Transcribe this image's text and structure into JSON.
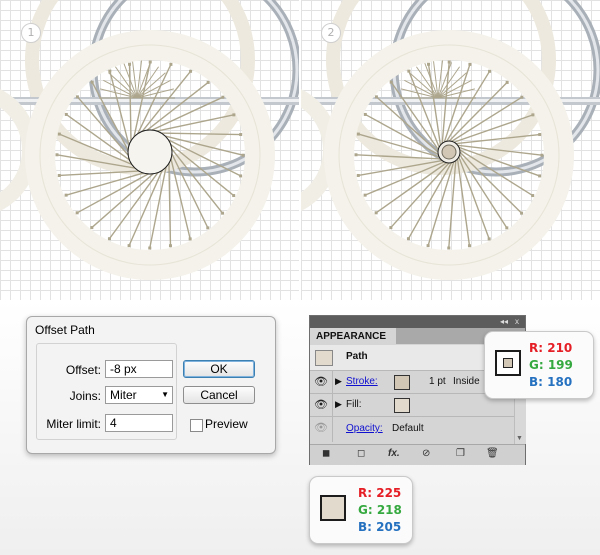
{
  "artboards": [
    {
      "step": "1"
    },
    {
      "step": "2"
    }
  ],
  "colors": {
    "wheel_outer": "#f4f2ea",
    "wheel_rim": "#ebe7dc",
    "spoke": "#ada68d",
    "chrome": "#9aa3ad",
    "hub_fill": "#f5f4ef",
    "stroke_swatch": "#d2c7b4",
    "fill_swatch": "#e1dacd"
  },
  "offset_dialog": {
    "title": "Offset Path",
    "offset_label": "Offset:",
    "offset_value": "-8 px",
    "joins_label": "Joins:",
    "joins_value": "Miter",
    "miter_label": "Miter limit:",
    "miter_value": "4",
    "ok_label": "OK",
    "cancel_label": "Cancel",
    "preview_label": "Preview"
  },
  "appearance_panel": {
    "tab_label": "APPEARANCE",
    "collapse_icon": "double-chevron-icon",
    "close_label": "x",
    "menu_icon": "panel-menu-icon",
    "path_label": "Path",
    "stroke_label": "Stroke:",
    "stroke_weight": "1 pt",
    "stroke_align": "Inside",
    "fill_label": "Fill:",
    "opacity_label": "Opacity:",
    "opacity_value": "Default",
    "footer_icons": [
      "add-stroke-icon",
      "add-fill-icon",
      "fx-icon",
      "clear-icon",
      "duplicate-icon",
      "trash-icon"
    ]
  },
  "stroke_color": {
    "r_label": "R: 210",
    "g_label": "G: 199",
    "b_label": "B: 180"
  },
  "fill_color": {
    "r_label": "R: 225",
    "g_label": "G: 218",
    "b_label": "B: 205"
  }
}
